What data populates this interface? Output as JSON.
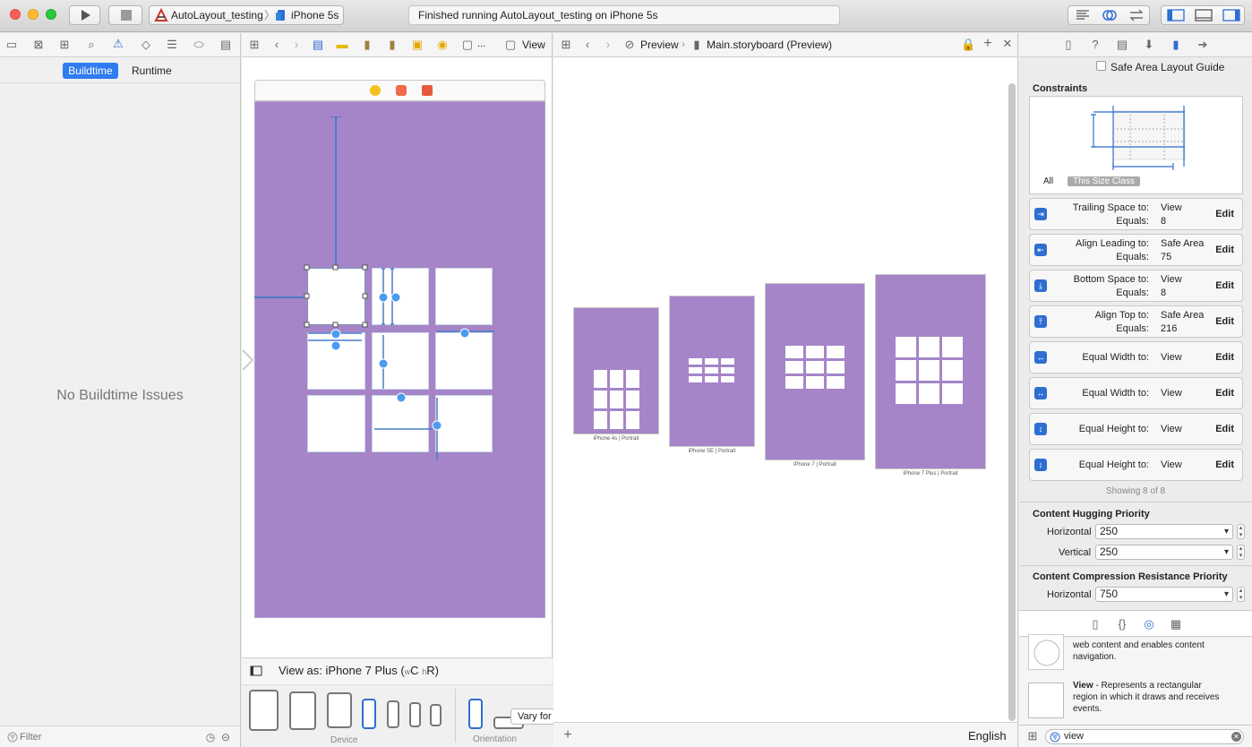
{
  "toolbar": {
    "scheme_target": "AutoLayout_testing",
    "scheme_device": "iPhone 5s",
    "status_text": "Finished running AutoLayout_testing on iPhone 5s"
  },
  "navigator": {
    "segments": [
      "Buildtime",
      "Runtime"
    ],
    "empty_message": "No Buildtime Issues",
    "filter_placeholder": "Filter"
  },
  "editor": {
    "jump_last": "View",
    "jump_ellipsis": "...",
    "view_as_label": "View as: iPhone 7 Plus (",
    "view_as_w": "w",
    "view_as_c": "C",
    "view_as_h": "h",
    "view_as_r": "R)",
    "device_label": "Device",
    "orientation_label": "Orientation",
    "vary_label": "Vary for"
  },
  "preview": {
    "jump_preview": "Preview",
    "jump_file": "Main.storyboard (Preview)",
    "language": "English",
    "devices": [
      "iPhone 4s | Portrait",
      "iPhone SE | Portrait",
      "iPhone 7 | Portrait",
      "iPhone 7 Plus | Portrait"
    ]
  },
  "inspector": {
    "safe_area_label": "Safe Area Layout Guide",
    "constraints_header": "Constraints",
    "tab_all": "All",
    "tab_size_class": "This Size Class",
    "constraints": [
      {
        "label1": "Trailing Space to:",
        "value1": "View",
        "label2": "Equals:",
        "value2": "8",
        "edit": "Edit"
      },
      {
        "label1": "Align Leading to:",
        "value1": "Safe Area",
        "label2": "Equals:",
        "value2": "75",
        "edit": "Edit"
      },
      {
        "label1": "Bottom Space to:",
        "value1": "View",
        "label2": "Equals:",
        "value2": "8",
        "edit": "Edit"
      },
      {
        "label1": "Align Top to:",
        "value1": "Safe Area",
        "label2": "Equals:",
        "value2": "216",
        "edit": "Edit"
      },
      {
        "label1": "Equal Width to:",
        "value1": "View",
        "edit": "Edit"
      },
      {
        "label1": "Equal Width to:",
        "value1": "View",
        "edit": "Edit"
      },
      {
        "label1": "Equal Height to:",
        "value1": "View",
        "edit": "Edit"
      },
      {
        "label1": "Equal Height to:",
        "value1": "View",
        "edit": "Edit"
      }
    ],
    "showing": "Showing 8 of 8",
    "hugging_header": "Content Hugging Priority",
    "horizontal_label": "Horizontal",
    "vertical_label": "Vertical",
    "hugging_h": "250",
    "hugging_v": "250",
    "compression_header": "Content Compression Resistance Priority",
    "compression_h": "750",
    "library_item1_desc1": "web content and enables content",
    "library_item1_desc2": "navigation.",
    "library_item2_title": "View",
    "library_item2_desc1": "- Represents a rectangular",
    "library_item2_desc2": "region in which it draws and receives",
    "library_item2_desc3": "events.",
    "library_search": "view"
  },
  "colors": {
    "accent": "#2f6ed1",
    "canvas_purple": "#a585c8",
    "constraint_blue": "#4a7cc9"
  }
}
